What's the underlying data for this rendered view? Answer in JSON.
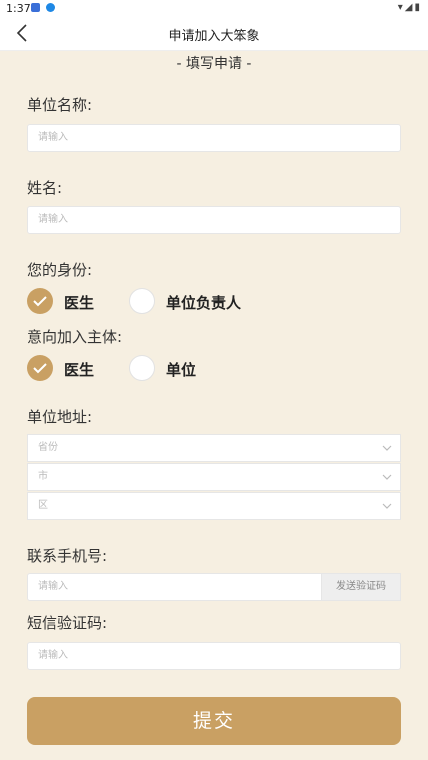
{
  "status_bar": {
    "time": "1:37"
  },
  "nav": {
    "title": "申请加入大笨象"
  },
  "form": {
    "section_title": "- 填写申请 -",
    "unit_name": {
      "label": "单位名称:",
      "placeholder": "请输入"
    },
    "name": {
      "label": "姓名:",
      "placeholder": "请输入"
    },
    "identity": {
      "label": "您的身份:",
      "options": [
        "医生",
        "单位负责人"
      ],
      "selected": "医生"
    },
    "intent": {
      "label": "意向加入主体:",
      "options": [
        "医生",
        "单位"
      ],
      "selected": "医生"
    },
    "address": {
      "label": "单位地址:",
      "province": "省份",
      "city": "市",
      "district": "区"
    },
    "phone": {
      "label": "联系手机号:",
      "placeholder": "请输入",
      "send_code": "发送验证码"
    },
    "sms": {
      "label": "短信验证码:",
      "placeholder": "请输入"
    },
    "submit": "提交"
  },
  "colors": {
    "accent": "#c9a063",
    "background": "#f6efe1"
  }
}
